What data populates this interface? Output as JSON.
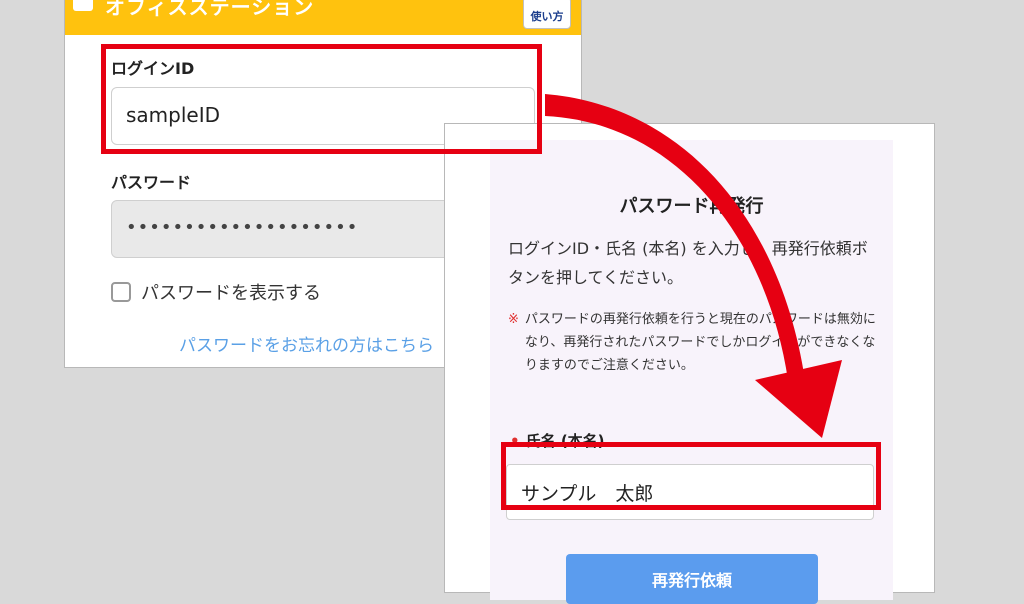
{
  "login": {
    "app_title": "オフィスステーション",
    "help_label": "使い方",
    "login_id_label": "ログインID",
    "login_id_value": "sampleID",
    "password_label": "パスワード",
    "password_value": "••••••••••••••••••••",
    "show_password_label": "パスワードを表示する",
    "forgot_link": "パスワードをお忘れの方はこちら"
  },
  "reissue": {
    "title": "パスワード再発行",
    "instruction": "ログインID・氏名 (本名) を入力し、再発行依頼ボタンを押してください。",
    "note_mark": "※",
    "note": "パスワードの再発行依頼を行うと現在のパスワードは無効になり、再発行されたパスワードでしかログインができなくなりますのでご注意ください。",
    "required_mark": "•",
    "fullname_label": "氏名 (本名)",
    "fullname_value": "サンプル　太郎",
    "submit_label": "再発行依頼"
  },
  "colors": {
    "header": "#ffc20e",
    "highlight": "#e60012",
    "button": "#5b9cee",
    "link": "#5aa0e6"
  }
}
